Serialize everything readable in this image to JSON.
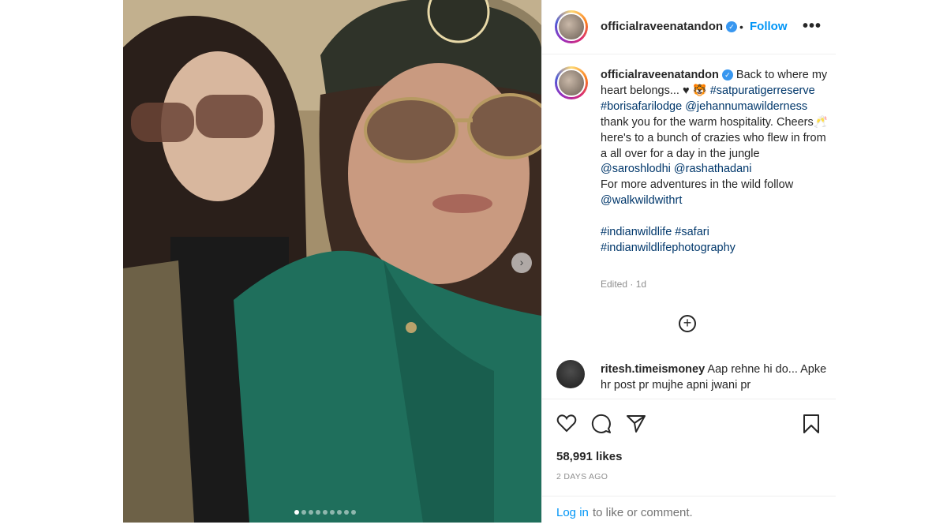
{
  "post": {
    "username": "officialraveenatandon",
    "follow_label": "Follow",
    "separator": "•",
    "more_label": "•••",
    "caption_parts": [
      "Back to where my heart belongs... ♥ 🐯 ",
      "#satpuratigerreserve #borisafarilodge @jehannumawilderness",
      " thank you for the warm hospitality. Cheers🥂 here's to a bunch of crazies who flew in from a all over for a day in the jungle ",
      "@saroshlodhi @rashathadani",
      " For more adventures in the wild follow ",
      "@walkwildwithrt",
      "#indianwildlife #safari #indianwildlifephotography"
    ],
    "edited": "Edited · 1d",
    "load_more": "+"
  },
  "comment": {
    "username": "ritesh.timeismoney",
    "text": "Aap rehne hi do... Apke hr post pr mujhe apni jwani pr"
  },
  "actions": {
    "likes": "58,991 likes",
    "timestamp": "2 DAYS AGO",
    "login_link": "Log in",
    "login_rest": "to like or comment."
  },
  "carousel": {
    "next_label": "›",
    "slide_count": 9,
    "active_slide": 1
  },
  "colors": {
    "link_blue": "#0095f6",
    "tag_blue": "#00376b",
    "muted": "#8e8e8e"
  }
}
